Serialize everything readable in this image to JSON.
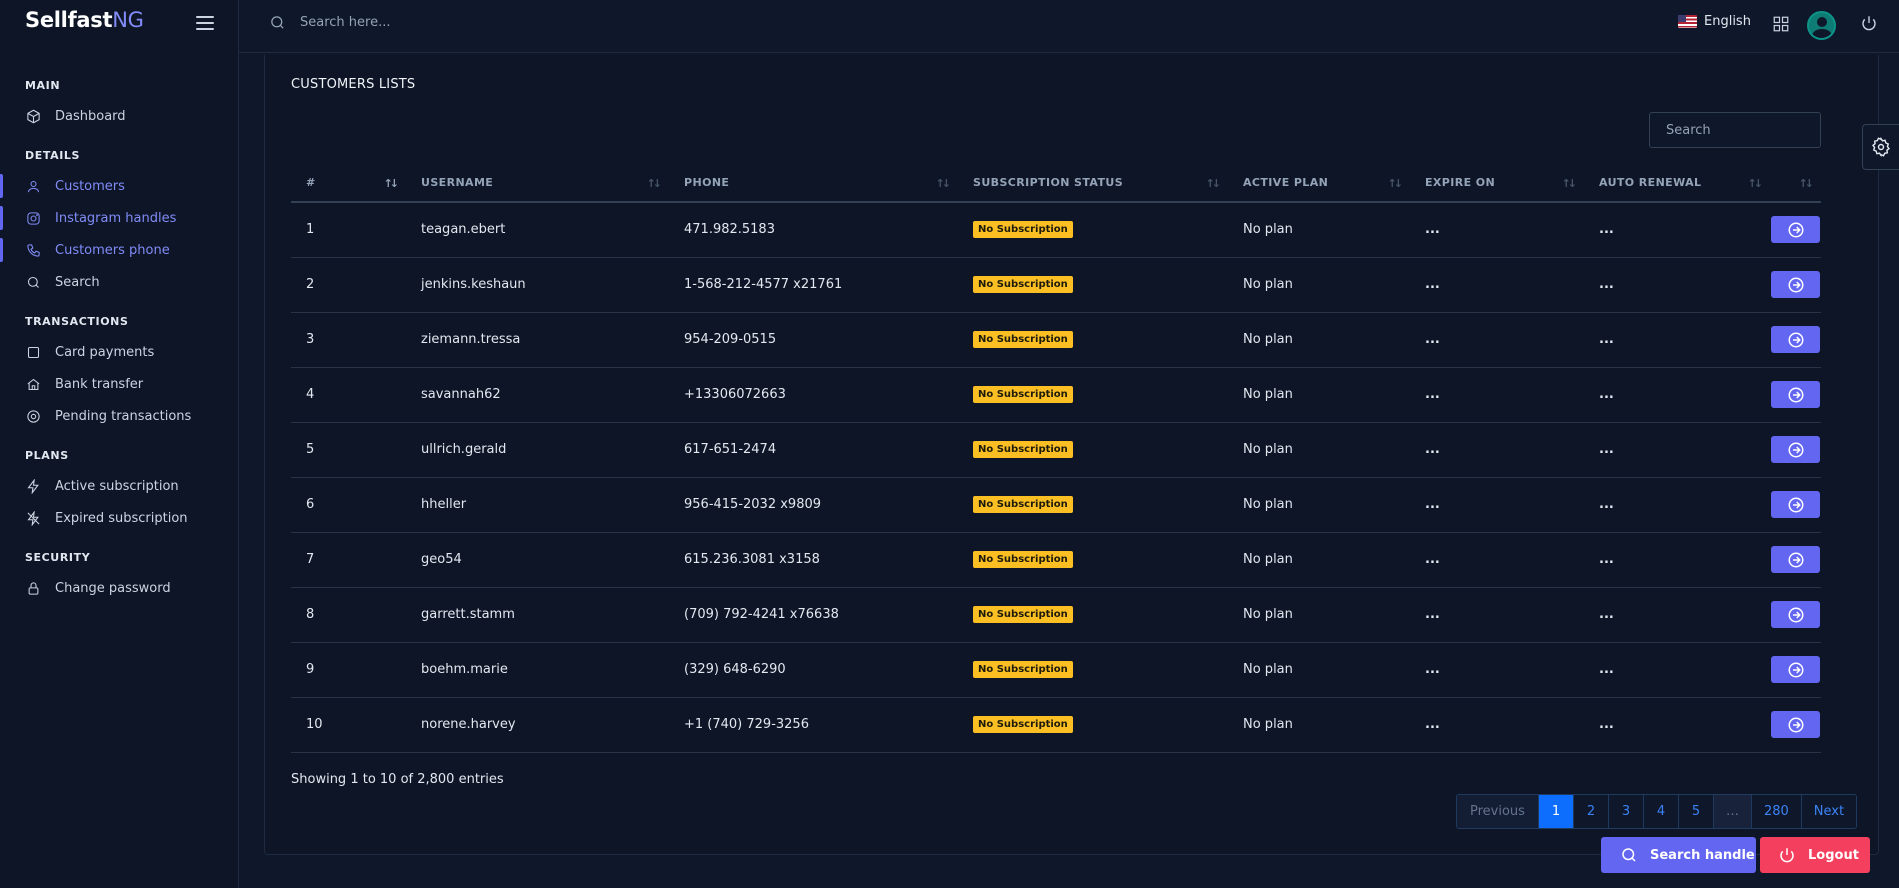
{
  "brand": {
    "name": "Sellfast",
    "suffix": "NG"
  },
  "topbar": {
    "search_placeholder": "Search here...",
    "language": "English"
  },
  "sidebar": {
    "sections": [
      {
        "title": "MAIN",
        "items": [
          {
            "label": "Dashboard",
            "icon": "cube-icon",
            "active": false
          }
        ]
      },
      {
        "title": "DETAILS",
        "items": [
          {
            "label": "Customers",
            "icon": "user-icon",
            "active": true
          },
          {
            "label": "Instagram handles",
            "icon": "instagram-icon",
            "active": true
          },
          {
            "label": "Customers phone",
            "icon": "phone-icon",
            "active": true
          },
          {
            "label": "Search",
            "icon": "search-icon",
            "active": false
          }
        ]
      },
      {
        "title": "TRANSACTIONS",
        "items": [
          {
            "label": "Card payments",
            "icon": "square-icon",
            "active": false
          },
          {
            "label": "Bank transfer",
            "icon": "home-icon",
            "active": false
          },
          {
            "label": "Pending transactions",
            "icon": "target-icon",
            "active": false
          }
        ]
      },
      {
        "title": "PLANS",
        "items": [
          {
            "label": "Active subscription",
            "icon": "bolt-icon",
            "active": false
          },
          {
            "label": "Expired subscription",
            "icon": "bolt-off-icon",
            "active": false
          }
        ]
      },
      {
        "title": "SECURITY",
        "items": [
          {
            "label": "Change password",
            "icon": "lock-icon",
            "active": false
          }
        ]
      }
    ]
  },
  "card": {
    "title": "CUSTOMERS LISTS",
    "search_placeholder": "Search",
    "columns": [
      "#",
      "USERNAME",
      "PHONE",
      "SUBSCRIPTION STATUS",
      "ACTIVE PLAN",
      "EXPIRE ON",
      "AUTO RENEWAL",
      ""
    ],
    "rows": [
      {
        "num": "1",
        "username": "teagan.ebert",
        "phone": "471.982.5183",
        "status": "No Subscription",
        "plan": "No plan",
        "expire": "...",
        "renewal": "..."
      },
      {
        "num": "2",
        "username": "jenkins.keshaun",
        "phone": "1-568-212-4577 x21761",
        "status": "No Subscription",
        "plan": "No plan",
        "expire": "...",
        "renewal": "..."
      },
      {
        "num": "3",
        "username": "ziemann.tressa",
        "phone": "954-209-0515",
        "status": "No Subscription",
        "plan": "No plan",
        "expire": "...",
        "renewal": "..."
      },
      {
        "num": "4",
        "username": "savannah62",
        "phone": "+13306072663",
        "status": "No Subscription",
        "plan": "No plan",
        "expire": "...",
        "renewal": "..."
      },
      {
        "num": "5",
        "username": "ullrich.gerald",
        "phone": "617-651-2474",
        "status": "No Subscription",
        "plan": "No plan",
        "expire": "...",
        "renewal": "..."
      },
      {
        "num": "6",
        "username": "hheller",
        "phone": "956-415-2032 x9809",
        "status": "No Subscription",
        "plan": "No plan",
        "expire": "...",
        "renewal": "..."
      },
      {
        "num": "7",
        "username": "geo54",
        "phone": "615.236.3081 x3158",
        "status": "No Subscription",
        "plan": "No plan",
        "expire": "...",
        "renewal": "..."
      },
      {
        "num": "8",
        "username": "garrett.stamm",
        "phone": "(709) 792-4241 x76638",
        "status": "No Subscription",
        "plan": "No plan",
        "expire": "...",
        "renewal": "..."
      },
      {
        "num": "9",
        "username": "boehm.marie",
        "phone": "(329) 648-6290",
        "status": "No Subscription",
        "plan": "No plan",
        "expire": "...",
        "renewal": "..."
      },
      {
        "num": "10",
        "username": "norene.harvey",
        "phone": "+1 (740) 729-3256",
        "status": "No Subscription",
        "plan": "No plan",
        "expire": "...",
        "renewal": "..."
      }
    ],
    "info": "Showing 1 to 10 of 2,800 entries",
    "pagination": [
      "Previous",
      "1",
      "2",
      "3",
      "4",
      "5",
      "…",
      "280",
      "Next"
    ],
    "current_page": "1"
  },
  "buttons": {
    "search_handle": "Search handle",
    "logout": "Logout"
  },
  "colors": {
    "accent": "#6366f1",
    "badge": "#fbbf24",
    "logout": "#f43f5e",
    "page_active": "#0d6efd"
  }
}
